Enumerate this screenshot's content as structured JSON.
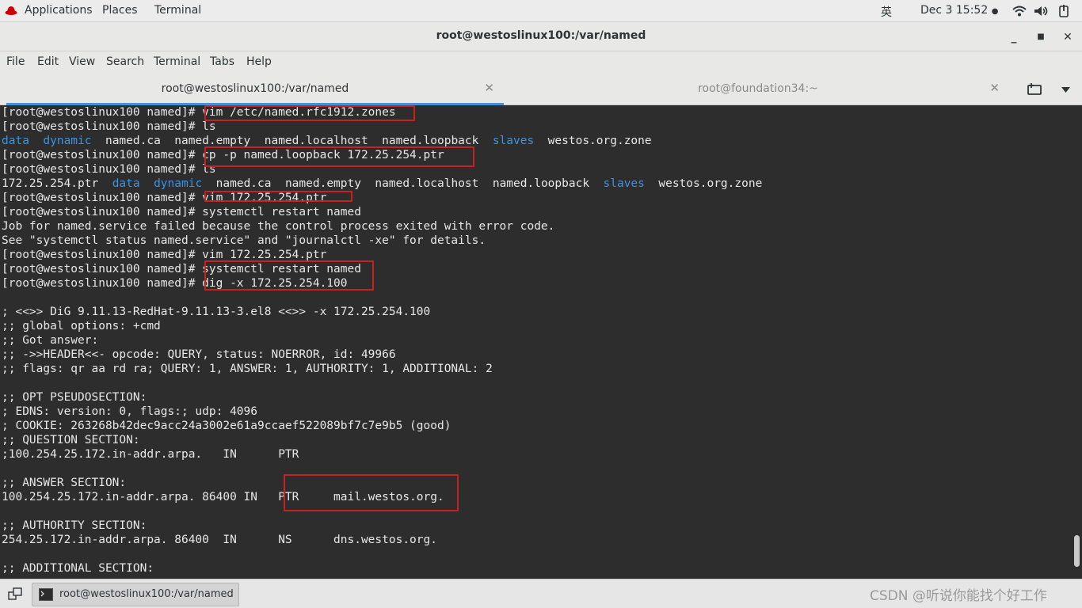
{
  "topbar": {
    "applications": "Applications",
    "places": "Places",
    "terminal": "Terminal",
    "input_method": "英",
    "datetime": "Dec 3  15:52",
    "icons": [
      "redhat-logo-icon",
      "wifi-icon",
      "volume-icon",
      "power-icon"
    ]
  },
  "window": {
    "title": "root@westoslinux100:/var/named",
    "buttons": [
      "minimize",
      "maximize",
      "close"
    ]
  },
  "menu": [
    "File",
    "Edit",
    "View",
    "Search",
    "Terminal",
    "Tabs",
    "Help"
  ],
  "tabs": [
    {
      "label": "root@westoslinux100:/var/named",
      "active": true
    },
    {
      "label": "root@foundation34:~",
      "active": false
    }
  ],
  "terminal": {
    "lines": [
      [
        {
          "t": "[root@westoslinux100 named]# vim /etc/named.rfc1912.zones"
        }
      ],
      [
        {
          "t": "[root@westoslinux100 named]# ls"
        }
      ],
      [
        {
          "t": "data",
          "c": "blue"
        },
        {
          "t": "  "
        },
        {
          "t": "dynamic",
          "c": "blue"
        },
        {
          "t": "  named.ca  named.empty  named.localhost  named.loopback  "
        },
        {
          "t": "slaves",
          "c": "blue"
        },
        {
          "t": "  westos.org.zone"
        }
      ],
      [
        {
          "t": "[root@westoslinux100 named]# cp -p named.loopback 172.25.254.ptr"
        }
      ],
      [
        {
          "t": "[root@westoslinux100 named]# ls"
        }
      ],
      [
        {
          "t": "172.25.254.ptr  "
        },
        {
          "t": "data",
          "c": "blue"
        },
        {
          "t": "  "
        },
        {
          "t": "dynamic",
          "c": "blue"
        },
        {
          "t": "  named.ca  named.empty  named.localhost  named.loopback  "
        },
        {
          "t": "slaves",
          "c": "blue"
        },
        {
          "t": "  westos.org.zone"
        }
      ],
      [
        {
          "t": "[root@westoslinux100 named]# vim 172.25.254.ptr"
        }
      ],
      [
        {
          "t": "[root@westoslinux100 named]# systemctl restart named"
        }
      ],
      [
        {
          "t": "Job for named.service failed because the control process exited with error code."
        }
      ],
      [
        {
          "t": "See \"systemctl status named.service\" and \"journalctl -xe\" for details."
        }
      ],
      [
        {
          "t": "[root@westoslinux100 named]# vim 172.25.254.ptr"
        }
      ],
      [
        {
          "t": "[root@westoslinux100 named]# systemctl restart named"
        }
      ],
      [
        {
          "t": "[root@westoslinux100 named]# dig -x 172.25.254.100"
        }
      ],
      [
        {
          "t": ""
        }
      ],
      [
        {
          "t": "; <<>> DiG 9.11.13-RedHat-9.11.13-3.el8 <<>> -x 172.25.254.100"
        }
      ],
      [
        {
          "t": ";; global options: +cmd"
        }
      ],
      [
        {
          "t": ";; Got answer:"
        }
      ],
      [
        {
          "t": ";; ->>HEADER<<- opcode: QUERY, status: NOERROR, id: 49966"
        }
      ],
      [
        {
          "t": ";; flags: qr aa rd ra; QUERY: 1, ANSWER: 1, AUTHORITY: 1, ADDITIONAL: 2"
        }
      ],
      [
        {
          "t": ""
        }
      ],
      [
        {
          "t": ";; OPT PSEUDOSECTION:"
        }
      ],
      [
        {
          "t": "; EDNS: version: 0, flags:; udp: 4096"
        }
      ],
      [
        {
          "t": "; COOKIE: 263268b42dec9acc24a3002e61a9ccaef522089bf7c7e9b5 (good)"
        }
      ],
      [
        {
          "t": ";; QUESTION SECTION:"
        }
      ],
      [
        {
          "t": ";100.254.25.172.in-addr.arpa.   IN      PTR"
        }
      ],
      [
        {
          "t": ""
        }
      ],
      [
        {
          "t": ";; ANSWER SECTION:"
        }
      ],
      [
        {
          "t": "100.254.25.172.in-addr.arpa. 86400 IN   PTR     mail.westos.org."
        }
      ],
      [
        {
          "t": ""
        }
      ],
      [
        {
          "t": ";; AUTHORITY SECTION:"
        }
      ],
      [
        {
          "t": "254.25.172.in-addr.arpa. 86400  IN      NS      dns.westos.org."
        }
      ],
      [
        {
          "t": ""
        }
      ],
      [
        {
          "t": ";; ADDITIONAL SECTION:"
        }
      ]
    ]
  },
  "taskbar": {
    "window_label": "root@westoslinux100:/var/named",
    "watermark": "CSDN @听说你能找个好工作"
  }
}
